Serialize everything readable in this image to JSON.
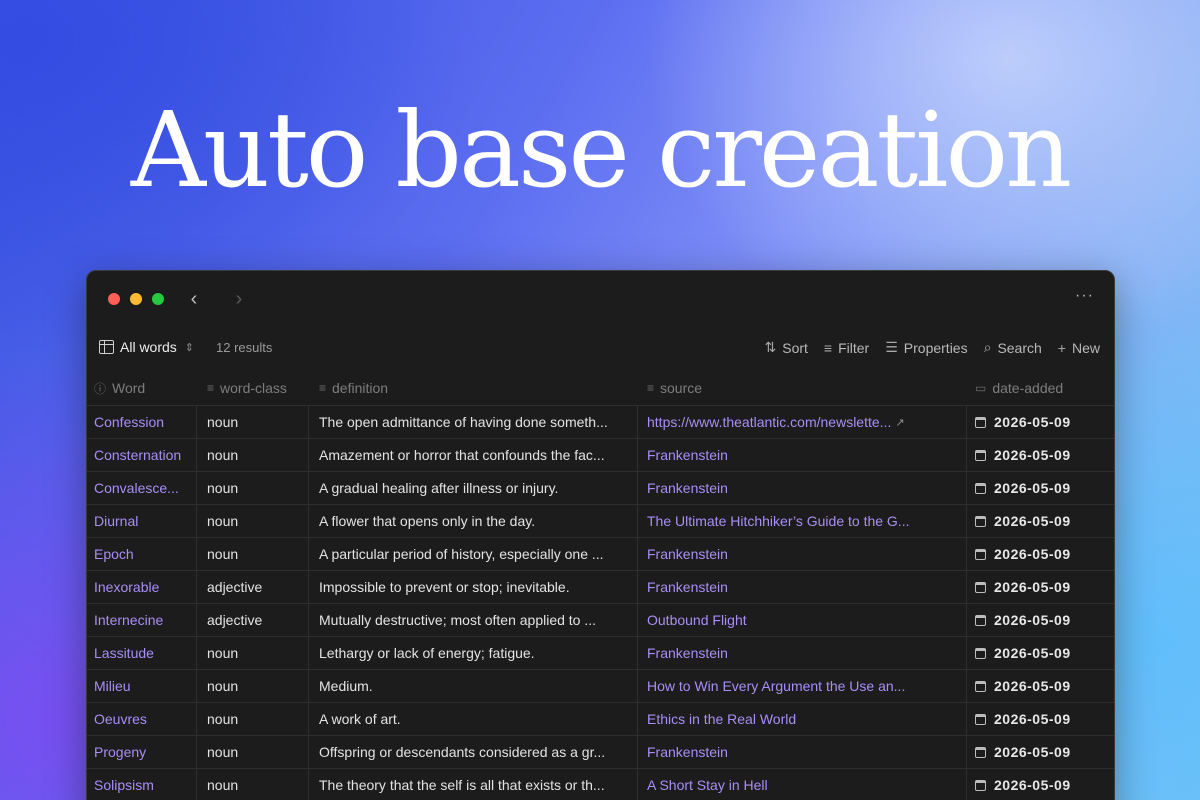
{
  "headline": "Auto base creation",
  "window": {
    "more_label": "···",
    "back_label": "‹",
    "forward_label": "›"
  },
  "toolbar": {
    "view_label": "All words",
    "results": "12 results",
    "sort_label": "Sort",
    "filter_label": "Filter",
    "properties_label": "Properties",
    "search_label": "Search",
    "new_label": "New"
  },
  "columns": [
    "Word",
    "word-class",
    "definition",
    "source",
    "date-added"
  ],
  "rows": [
    {
      "word": "Confession",
      "word_class": "noun",
      "definition": "The open admittance of having done someth...",
      "source": "https://www.theatlantic.com/newslette...",
      "date": "2026-05-09"
    },
    {
      "word": "Consternation",
      "word_class": "noun",
      "definition": "Amazement or horror that confounds the fac...",
      "source": "Frankenstein",
      "date": "2026-05-09"
    },
    {
      "word": "Convalesce...",
      "word_class": "noun",
      "definition": "A gradual healing after illness or injury.",
      "source": "Frankenstein",
      "date": "2026-05-09"
    },
    {
      "word": "Diurnal",
      "word_class": "noun",
      "definition": "A flower that opens only in the day.",
      "source": "The Ultimate Hitchhiker’s Guide to the G...",
      "date": "2026-05-09"
    },
    {
      "word": "Epoch",
      "word_class": "noun",
      "definition": "A particular period of history, especially one ...",
      "source": "Frankenstein",
      "date": "2026-05-09"
    },
    {
      "word": "Inexorable",
      "word_class": "adjective",
      "definition": "Impossible to prevent or stop; inevitable.",
      "source": "Frankenstein",
      "date": "2026-05-09"
    },
    {
      "word": "Internecine",
      "word_class": "adjective",
      "definition": "Mutually destructive; most often applied to ...",
      "source": "Outbound Flight",
      "date": "2026-05-09"
    },
    {
      "word": "Lassitude",
      "word_class": "noun",
      "definition": "Lethargy or lack of energy; fatigue.",
      "source": "Frankenstein",
      "date": "2026-05-09"
    },
    {
      "word": "Milieu",
      "word_class": "noun",
      "definition": "Medium.",
      "source": "How to Win Every Argument the Use an...",
      "date": "2026-05-09"
    },
    {
      "word": "Oeuvres",
      "word_class": "noun",
      "definition": "A work of art.",
      "source": "Ethics in the Real World",
      "date": "2026-05-09"
    },
    {
      "word": "Progeny",
      "word_class": "noun",
      "definition": "Offspring or descendants considered as a gr...",
      "source": "Frankenstein",
      "date": "2026-05-09"
    },
    {
      "word": "Solipsism",
      "word_class": "noun",
      "definition": "The theory that the self is all that exists or th...",
      "source": "A Short Stay in Hell",
      "date": "2026-05-09"
    }
  ],
  "colors": {
    "link": "#a88ef5",
    "window_bg": "#1c1c1c",
    "close": "#ff5f57",
    "minimize": "#febc2e",
    "maximize": "#28c840"
  }
}
